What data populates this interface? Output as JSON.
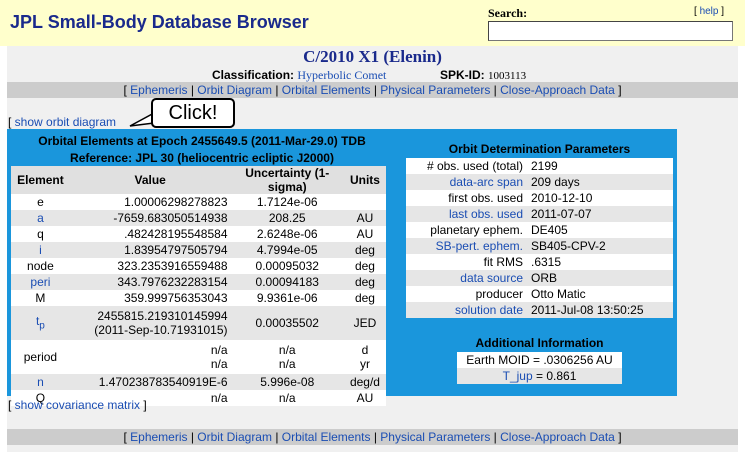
{
  "header": {
    "title": "JPL Small-Body Database Browser",
    "search_label": "Search:",
    "search_value": "",
    "help_label": "help"
  },
  "object": {
    "title": "C/2010 X1 (Elenin)",
    "classification_label": "Classification:",
    "classification_value": "Hyperbolic Comet",
    "spk_label": "SPK-ID:",
    "spk_value": "1003113"
  },
  "nav": {
    "items": [
      "Ephemeris",
      "Orbit Diagram",
      "Orbital Elements",
      "Physical Parameters",
      "Close-Approach Data"
    ]
  },
  "orbit_diagram_link": "show orbit diagram",
  "callout": "Click!",
  "elements": {
    "heading1": "Orbital Elements at Epoch 2455649.5 (2011-Mar-29.0) TDB",
    "heading2": "Reference: JPL 30 (heliocentric ecliptic J2000)",
    "columns": [
      "Element",
      "Value",
      "Uncertainty (1-sigma)",
      "Units"
    ],
    "rows": [
      {
        "el": "e",
        "value": "1.00006298278823",
        "unc": "1.7124e-06",
        "units": ""
      },
      {
        "el": "a",
        "value": "-7659.683050514938",
        "unc": "208.25",
        "units": "AU"
      },
      {
        "el": "q",
        "value": ".482428195548584",
        "unc": "2.6248e-06",
        "units": "AU"
      },
      {
        "el": "i",
        "value": "1.83954797505794",
        "unc": "4.7994e-05",
        "units": "deg"
      },
      {
        "el": "node",
        "value": "323.2353916559488",
        "unc": "0.00095032",
        "units": "deg"
      },
      {
        "el": "peri",
        "value": "343.7976232283154",
        "unc": "0.00094183",
        "units": "deg"
      },
      {
        "el": "M",
        "value": "359.999756353043",
        "unc": "9.9361e-06",
        "units": "deg"
      },
      {
        "el": "t",
        "el_sub": "p",
        "value": "2455815.219310145994",
        "value2": "(2011-Sep-10.71931015)",
        "unc": "0.00035502",
        "units": "JED"
      },
      {
        "el": "period",
        "value": "n/a",
        "value2": "n/a",
        "unc": "n/a",
        "unc2": "n/a",
        "units": "d",
        "units2": "yr"
      },
      {
        "el": "n",
        "value": "1.470238783540919E-6",
        "unc": "5.996e-08",
        "units": "deg/d"
      },
      {
        "el": "Q",
        "value": "n/a",
        "unc": "n/a",
        "units": "AU"
      }
    ]
  },
  "orbit_determination": {
    "title": "Orbit Determination Parameters",
    "rows": [
      {
        "k": "# obs. used (total)",
        "v": "2199"
      },
      {
        "k": "data-arc span",
        "v": "209 days"
      },
      {
        "k": "first obs. used",
        "v": "2010-12-10"
      },
      {
        "k": "last obs. used",
        "v": "2011-07-07"
      },
      {
        "k": "planetary ephem.",
        "v": "DE405"
      },
      {
        "k": "SB-pert. ephem.",
        "v": "SB405-CPV-2"
      },
      {
        "k": "fit RMS",
        "v": ".6315"
      },
      {
        "k": "data source",
        "v": "ORB"
      },
      {
        "k": "producer",
        "v": "Otto Matic"
      },
      {
        "k": "solution date",
        "v": "2011-Jul-08 13:50:25"
      }
    ]
  },
  "additional": {
    "title": "Additional Information",
    "moid_label": "Earth MOID =",
    "moid_value": ".0306256 AU",
    "tjup_label": "T_jup",
    "tjup_value": "= 0.861"
  },
  "covariance_link": "show covariance matrix",
  "colors": {
    "title_blue": "#1a2a8c",
    "link_blue": "#1a4db3",
    "panel_blue": "#1a96dc",
    "header_yellow": "#ffffcc"
  }
}
